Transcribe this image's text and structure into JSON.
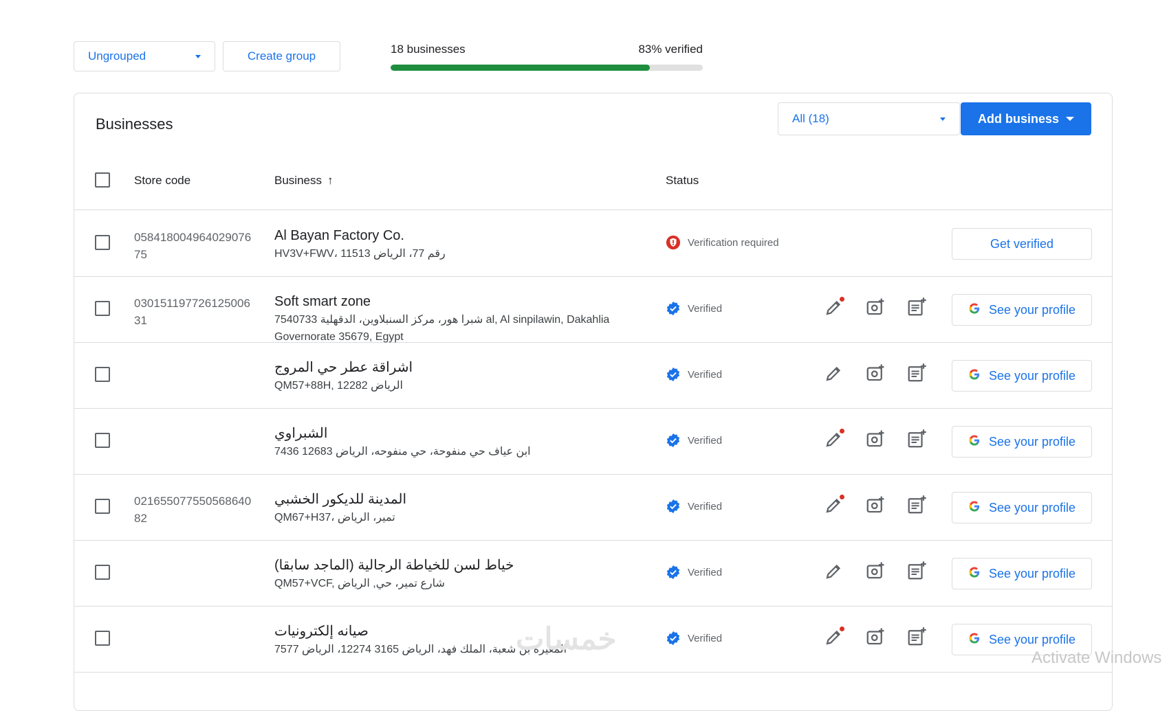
{
  "toolbar": {
    "group_select": "Ungrouped",
    "create_group": "Create group",
    "businesses_count": "18 businesses",
    "verified_pct": "83% verified",
    "verified_fraction": 0.83
  },
  "card": {
    "title": "Businesses",
    "filter": "All (18)",
    "add_business": "Add business"
  },
  "columns": {
    "store_code": "Store code",
    "business": "Business",
    "status": "Status"
  },
  "rows": [
    {
      "store_code": "05841800496402907675",
      "name": "Al Bayan Factory Co.",
      "address": "HV3V+FWV، 11513 رقم 77، الرياض",
      "status": "Verification required",
      "verified": false,
      "button": "Get verified",
      "edit_dot": false
    },
    {
      "store_code": "03015119772612500631",
      "name": "Soft smart zone",
      "address": "7540733 شبرا هور، مركز السنبلاوين، الدقهلية al, Al sinpilawin, Dakahlia Governorate 35679, Egypt",
      "status": "Verified",
      "verified": true,
      "button": "See your profile",
      "edit_dot": true
    },
    {
      "store_code": "",
      "name": "اشراقة عطر حي المروج",
      "address": "QM57+88H, 12282 الرياض",
      "status": "Verified",
      "verified": true,
      "button": "See your profile",
      "edit_dot": false
    },
    {
      "store_code": "",
      "name": "الشبراوي",
      "address": "7436 12683 ابن عياف حي منفوحة، حي منفوحه، الرياض",
      "status": "Verified",
      "verified": true,
      "button": "See your profile",
      "edit_dot": true
    },
    {
      "store_code": "02165507755056864082",
      "name": "المدينة للديكور الخشبي",
      "address": "QM67+H37، تمير، الرياض",
      "status": "Verified",
      "verified": true,
      "button": "See your profile",
      "edit_dot": true
    },
    {
      "store_code": "",
      "name": "خياط لسن للخياطة الرجالية (الماجد سابقا)",
      "address": "QM57+VCF, شارع تمير، حي, الرياض",
      "status": "Verified",
      "verified": true,
      "button": "See your profile",
      "edit_dot": false
    },
    {
      "store_code": "",
      "name": "صيانه إلكترونيات",
      "address": "7577 المغيرة بن شعبة، الملك فهد، الرياض 3165 12274، الرياض",
      "status": "Verified",
      "verified": true,
      "button": "See your profile",
      "edit_dot": true
    }
  ],
  "watermark": "Activate Windows",
  "logo_text": "خمسات",
  "colors": {
    "accent": "#1a73e8",
    "progress": "#1e8e3e",
    "verified": "#1a73e8",
    "warning": "#d93025"
  }
}
